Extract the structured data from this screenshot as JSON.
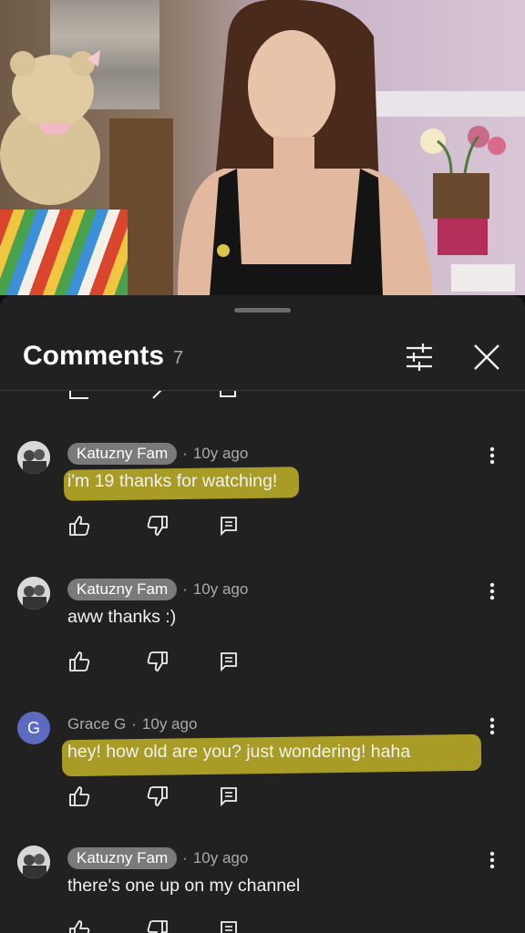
{
  "sheet": {
    "title": "Comments",
    "count": "7"
  },
  "icons": {
    "filter": "tune-sliders-icon",
    "close": "close-icon",
    "like": "thumb-up-icon",
    "dislike": "thumb-down-icon",
    "reply": "reply-comment-icon",
    "menu": "more-vertical-icon"
  },
  "colors": {
    "sheet_bg": "#212121",
    "highlight": "#d6c428",
    "avatar_letter_bg": "#5c6bc0"
  },
  "comments": [
    {
      "author": "Katuzny Fam",
      "time": "10y ago",
      "text": "i'm 19 thanks for watching!",
      "highlighted": true
    },
    {
      "author": "Katuzny Fam",
      "time": "10y ago",
      "text": "aww thanks :)",
      "highlighted": false
    },
    {
      "author": "Grace G",
      "avatar_letter": "G",
      "time": "10y ago",
      "text": "hey! how old are you? just wondering! haha",
      "highlighted": true
    },
    {
      "author": "Katuzny Fam",
      "time": "10y ago",
      "text": "there's one up on my channel",
      "highlighted": false
    }
  ]
}
